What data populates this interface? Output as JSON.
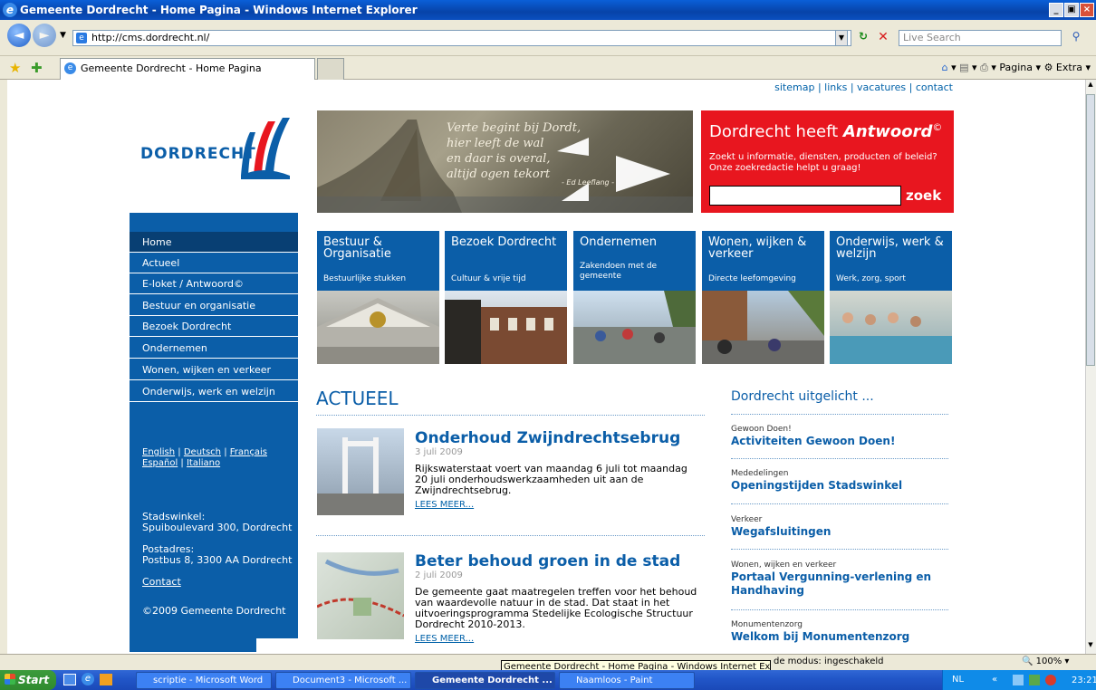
{
  "window": {
    "title": "Gemeente Dordrecht - Home Pagina - Windows Internet Explorer",
    "address": "http://cms.dordrecht.nl/",
    "search_placeholder": "Live Search",
    "tab_label": "Gemeente Dordrecht - Home Pagina",
    "cmd_page": "Pagina",
    "cmd_extra": "Extra"
  },
  "site": {
    "toplinks": "sitemap | links | vacatures | contact",
    "logo": "DORDRECHT",
    "quote": [
      "Verte begint bij Dordt,",
      "hier leeft de wal",
      "en daar is overal,",
      "altijd ogen tekort"
    ],
    "quote_author": "- Ed Leeflang -",
    "antwoord_title_a": "Dordrecht heeft ",
    "antwoord_title_b": "Antwoord",
    "antwoord_copy": "©",
    "antwoord_sub": "Zoekt u informatie, diensten, producten of beleid? Onze zoekredactie helpt u graag!",
    "zoek": "zoek",
    "brand_blue": "#0b5ea8",
    "brand_red": "#e8161f"
  },
  "sidebar": {
    "items": [
      {
        "label": "Home"
      },
      {
        "label": "Actueel"
      },
      {
        "label": "E-loket / Antwoord©"
      },
      {
        "label": "Bestuur en organisatie"
      },
      {
        "label": "Bezoek Dordrecht"
      },
      {
        "label": "Ondernemen"
      },
      {
        "label": "Wonen, wijken en verkeer"
      },
      {
        "label": "Onderwijs, werk en welzijn"
      }
    ],
    "lang_english": "English",
    "lang_deutsch": "Deutsch",
    "lang_francais": "Français",
    "lang_espanol": "Español",
    "lang_italiano": "Italiano",
    "stadswinkel_label": "Stadswinkel:",
    "stadswinkel_addr": "Spuiboulevard 300, Dordrecht",
    "postadres_label": "Postadres:",
    "postadres_addr": "Postbus 8, 3300 AA Dordrecht",
    "contact": "Contact",
    "copyright": "©2009 Gemeente Dordrecht"
  },
  "tiles": [
    {
      "title": "Bestuur & Organisatie",
      "sub": "Bestuurlijke stukken"
    },
    {
      "title": "Bezoek Dordrecht",
      "sub": "Cultuur & vrije tijd"
    },
    {
      "title": "Ondernemen",
      "sub": "Zakendoen met de gemeente"
    },
    {
      "title": "Wonen, wijken & verkeer",
      "sub": "Directe leefomgeving"
    },
    {
      "title": "Onderwijs, werk & welzijn",
      "sub": "Werk, zorg, sport"
    }
  ],
  "actueel": {
    "title": "ACTUEEL",
    "items": [
      {
        "title": "Onderhoud Zwijndrechtsebrug",
        "date": "3 juli 2009",
        "body": "Rijkswaterstaat voert van maandag 6 juli tot maandag 20 juli onderhoudswerkzaamheden uit aan de Zwijndrechtsebrug.",
        "more": "LEES MEER..."
      },
      {
        "title": "Beter behoud groen in de stad",
        "date": "2 juli 2009",
        "body": "De gemeente gaat maatregelen treffen voor het behoud van waardevolle natuur in de stad. Dat staat in het uitvoeringsprogramma Stedelijke Ecologische Structuur Dordrecht 2010-2013.",
        "more": "LEES MEER..."
      }
    ]
  },
  "uitgelicht": {
    "title": "Dordrecht uitgelicht ...",
    "items": [
      {
        "cat": "Gewoon Doen!",
        "title": "Activiteiten Gewoon Doen!"
      },
      {
        "cat": "Mededelingen",
        "title": "Openingstijden Stadswinkel"
      },
      {
        "cat": "Verkeer",
        "title": "Wegafsluitingen"
      },
      {
        "cat": "Wonen, wijken en verkeer",
        "title": "Portaal Vergunning-verlening en Handhaving"
      },
      {
        "cat": "Monumentenzorg",
        "title": "Welkom bij Monumentenzorg"
      }
    ]
  },
  "status": {
    "tooltip": "Gemeente Dordrecht - Home Pagina - Windows Internet Explorer",
    "mode": "de modus: ingeschakeld",
    "zoom": "100%"
  },
  "taskbar": {
    "start": "Start",
    "tasks": [
      "scriptie - Microsoft Word",
      "Document3 - Microsoft ...",
      "Gemeente Dordrecht ...",
      "Naamloos - Paint"
    ],
    "lang": "NL",
    "clock": "23:21"
  }
}
